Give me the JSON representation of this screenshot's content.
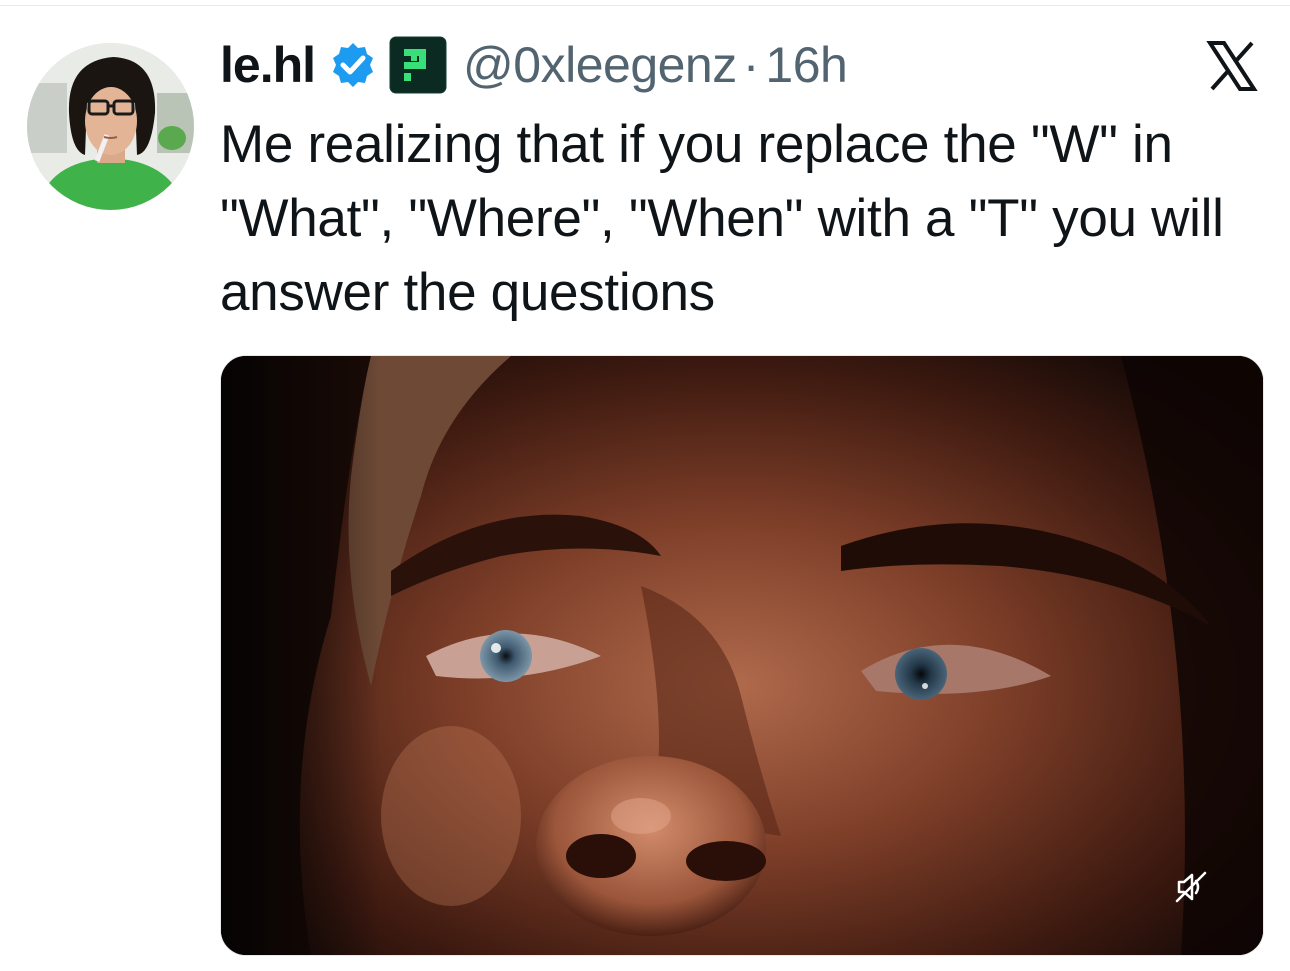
{
  "tweet": {
    "display_name": "le.hl",
    "handle": "@0xleegenz",
    "separator": "·",
    "timestamp": "16h",
    "text": "Me realizing that if you replace the \"W\" in \"What\", \"Where\", \"When\" with a \"T\" you will answer the questions"
  },
  "icons": {
    "verified": "verified-badge-icon",
    "affiliate": "affiliate-badge-icon",
    "brand": "x-logo-icon",
    "mute": "muted-speaker-icon"
  },
  "colors": {
    "text_primary": "#0f1419",
    "text_secondary": "#536471",
    "verified_blue": "#1d9bf0",
    "affiliate_bg": "#0b2a22",
    "affiliate_fg": "#39e07a"
  }
}
